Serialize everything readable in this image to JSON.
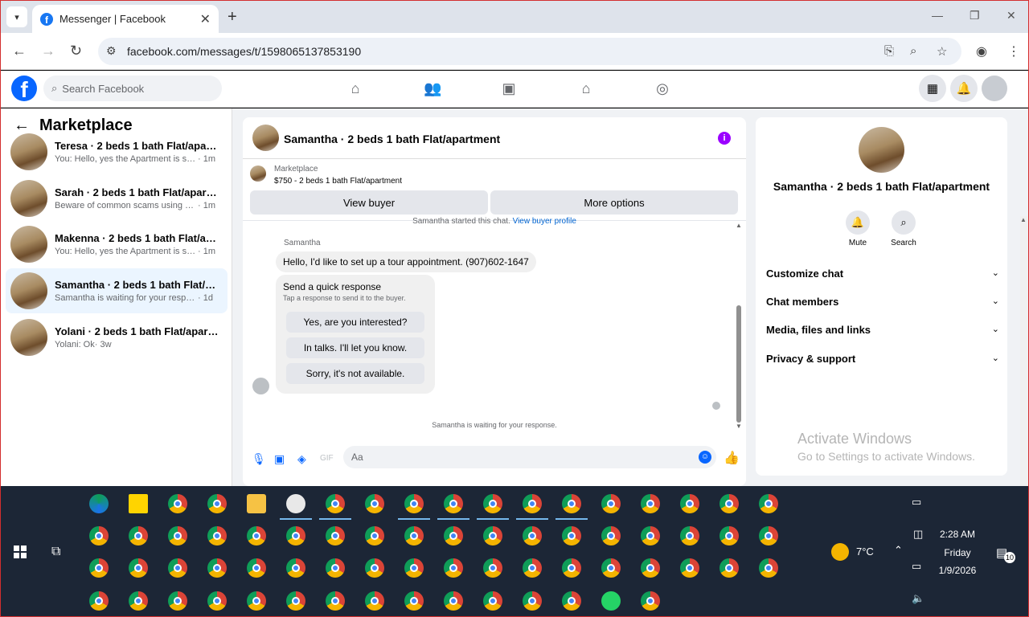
{
  "browser": {
    "tab_title": "Messenger | Facebook",
    "url": "facebook.com/messages/t/1598065137853190"
  },
  "fb": {
    "search_placeholder": "Search Facebook"
  },
  "left": {
    "heading": "Marketplace",
    "conversations": [
      {
        "name": "Teresa · 2 beds 1 bath Flat/apartm...",
        "preview": "You: Hello, yes the Apartment is still a...",
        "time": "· 1m",
        "selected": false
      },
      {
        "name": "Sarah · 2 beds 1 bath Flat/apartment",
        "preview": "Beware of common scams using pay...",
        "time": "· 1m",
        "selected": false
      },
      {
        "name": "Makenna · 2 beds 1 bath Flat/apart...",
        "preview": "You: Hello, yes the Apartment is still a...",
        "time": "· 1m",
        "selected": false
      },
      {
        "name": "Samantha · 2 beds 1 bath Flat/apar...",
        "preview": "Samantha is waiting for your response.",
        "time": "· 1d",
        "selected": true
      },
      {
        "name": "Yolani · 2 beds 1 bath Flat/apartme...",
        "preview": "Yolani: Ok",
        "time": "· 3w",
        "selected": false
      }
    ]
  },
  "chat": {
    "title": "Samantha · 2 beds 1 bath Flat/apartment",
    "marketplace_label": "Marketplace",
    "listing": "$750 - 2 beds 1 bath Flat/apartment",
    "view_buyer": "View buyer",
    "more_options": "More options",
    "started_text": "Samantha started this chat.",
    "started_link": "View buyer profile",
    "sender": "Samantha",
    "message": "Hello, I'd like to set up a tour appointment. (907)602-1647",
    "quick_title": "Send a quick response",
    "quick_sub": "Tap a response to send it to the buyer.",
    "quick_replies": [
      "Yes, are you interested?",
      "In talks. I'll let you know.",
      "Sorry, it's not available."
    ],
    "waiting": "Samantha is waiting for your response.",
    "composer_placeholder": "Aa"
  },
  "right": {
    "name": "Samantha · 2 beds 1 bath Flat/apartment",
    "mute": "Mute",
    "search": "Search",
    "sections": [
      "Customize chat",
      "Chat members",
      "Media, files and links",
      "Privacy & support"
    ]
  },
  "watermark": {
    "line1": "Activate Windows",
    "line2": "Go to Settings to activate Windows."
  },
  "taskbar": {
    "temperature": "7°C",
    "time": "2:28 AM",
    "day": "Friday",
    "date": "1/9/2026",
    "notifications": "10"
  }
}
